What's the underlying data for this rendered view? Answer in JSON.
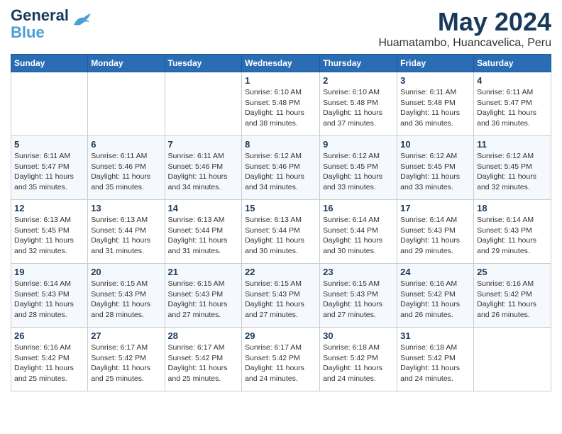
{
  "header": {
    "logo_general": "General",
    "logo_blue": "Blue",
    "month_title": "May 2024",
    "location": "Huamatambo, Huancavelica, Peru"
  },
  "weekdays": [
    "Sunday",
    "Monday",
    "Tuesday",
    "Wednesday",
    "Thursday",
    "Friday",
    "Saturday"
  ],
  "weeks": [
    [
      {
        "day": "",
        "info": ""
      },
      {
        "day": "",
        "info": ""
      },
      {
        "day": "",
        "info": ""
      },
      {
        "day": "1",
        "info": "Sunrise: 6:10 AM\nSunset: 5:48 PM\nDaylight: 11 hours\nand 38 minutes."
      },
      {
        "day": "2",
        "info": "Sunrise: 6:10 AM\nSunset: 5:48 PM\nDaylight: 11 hours\nand 37 minutes."
      },
      {
        "day": "3",
        "info": "Sunrise: 6:11 AM\nSunset: 5:48 PM\nDaylight: 11 hours\nand 36 minutes."
      },
      {
        "day": "4",
        "info": "Sunrise: 6:11 AM\nSunset: 5:47 PM\nDaylight: 11 hours\nand 36 minutes."
      }
    ],
    [
      {
        "day": "5",
        "info": "Sunrise: 6:11 AM\nSunset: 5:47 PM\nDaylight: 11 hours\nand 35 minutes."
      },
      {
        "day": "6",
        "info": "Sunrise: 6:11 AM\nSunset: 5:46 PM\nDaylight: 11 hours\nand 35 minutes."
      },
      {
        "day": "7",
        "info": "Sunrise: 6:11 AM\nSunset: 5:46 PM\nDaylight: 11 hours\nand 34 minutes."
      },
      {
        "day": "8",
        "info": "Sunrise: 6:12 AM\nSunset: 5:46 PM\nDaylight: 11 hours\nand 34 minutes."
      },
      {
        "day": "9",
        "info": "Sunrise: 6:12 AM\nSunset: 5:45 PM\nDaylight: 11 hours\nand 33 minutes."
      },
      {
        "day": "10",
        "info": "Sunrise: 6:12 AM\nSunset: 5:45 PM\nDaylight: 11 hours\nand 33 minutes."
      },
      {
        "day": "11",
        "info": "Sunrise: 6:12 AM\nSunset: 5:45 PM\nDaylight: 11 hours\nand 32 minutes."
      }
    ],
    [
      {
        "day": "12",
        "info": "Sunrise: 6:13 AM\nSunset: 5:45 PM\nDaylight: 11 hours\nand 32 minutes."
      },
      {
        "day": "13",
        "info": "Sunrise: 6:13 AM\nSunset: 5:44 PM\nDaylight: 11 hours\nand 31 minutes."
      },
      {
        "day": "14",
        "info": "Sunrise: 6:13 AM\nSunset: 5:44 PM\nDaylight: 11 hours\nand 31 minutes."
      },
      {
        "day": "15",
        "info": "Sunrise: 6:13 AM\nSunset: 5:44 PM\nDaylight: 11 hours\nand 30 minutes."
      },
      {
        "day": "16",
        "info": "Sunrise: 6:14 AM\nSunset: 5:44 PM\nDaylight: 11 hours\nand 30 minutes."
      },
      {
        "day": "17",
        "info": "Sunrise: 6:14 AM\nSunset: 5:43 PM\nDaylight: 11 hours\nand 29 minutes."
      },
      {
        "day": "18",
        "info": "Sunrise: 6:14 AM\nSunset: 5:43 PM\nDaylight: 11 hours\nand 29 minutes."
      }
    ],
    [
      {
        "day": "19",
        "info": "Sunrise: 6:14 AM\nSunset: 5:43 PM\nDaylight: 11 hours\nand 28 minutes."
      },
      {
        "day": "20",
        "info": "Sunrise: 6:15 AM\nSunset: 5:43 PM\nDaylight: 11 hours\nand 28 minutes."
      },
      {
        "day": "21",
        "info": "Sunrise: 6:15 AM\nSunset: 5:43 PM\nDaylight: 11 hours\nand 27 minutes."
      },
      {
        "day": "22",
        "info": "Sunrise: 6:15 AM\nSunset: 5:43 PM\nDaylight: 11 hours\nand 27 minutes."
      },
      {
        "day": "23",
        "info": "Sunrise: 6:15 AM\nSunset: 5:43 PM\nDaylight: 11 hours\nand 27 minutes."
      },
      {
        "day": "24",
        "info": "Sunrise: 6:16 AM\nSunset: 5:42 PM\nDaylight: 11 hours\nand 26 minutes."
      },
      {
        "day": "25",
        "info": "Sunrise: 6:16 AM\nSunset: 5:42 PM\nDaylight: 11 hours\nand 26 minutes."
      }
    ],
    [
      {
        "day": "26",
        "info": "Sunrise: 6:16 AM\nSunset: 5:42 PM\nDaylight: 11 hours\nand 25 minutes."
      },
      {
        "day": "27",
        "info": "Sunrise: 6:17 AM\nSunset: 5:42 PM\nDaylight: 11 hours\nand 25 minutes."
      },
      {
        "day": "28",
        "info": "Sunrise: 6:17 AM\nSunset: 5:42 PM\nDaylight: 11 hours\nand 25 minutes."
      },
      {
        "day": "29",
        "info": "Sunrise: 6:17 AM\nSunset: 5:42 PM\nDaylight: 11 hours\nand 24 minutes."
      },
      {
        "day": "30",
        "info": "Sunrise: 6:18 AM\nSunset: 5:42 PM\nDaylight: 11 hours\nand 24 minutes."
      },
      {
        "day": "31",
        "info": "Sunrise: 6:18 AM\nSunset: 5:42 PM\nDaylight: 11 hours\nand 24 minutes."
      },
      {
        "day": "",
        "info": ""
      }
    ]
  ]
}
